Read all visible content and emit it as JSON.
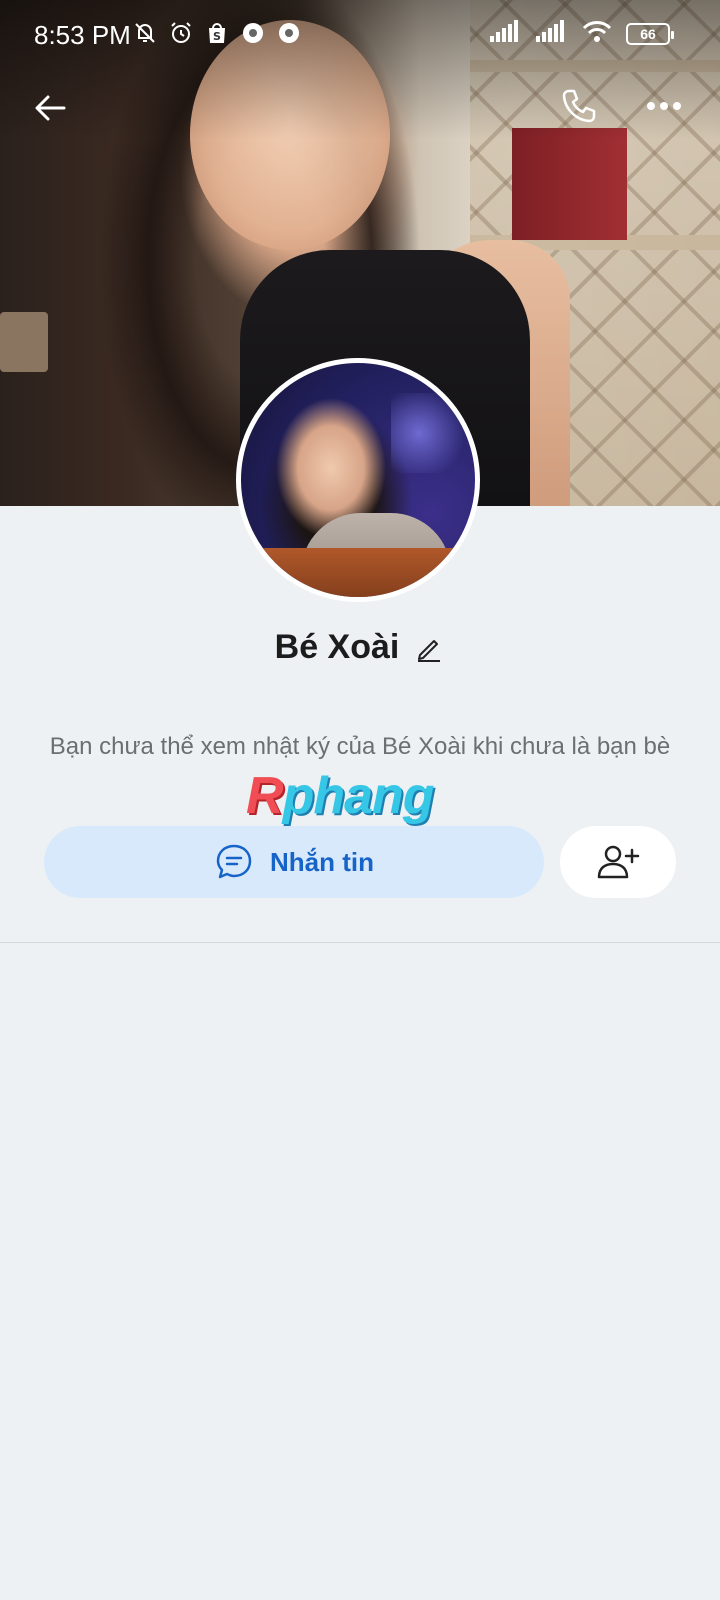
{
  "status_bar": {
    "time": "8:53 PM",
    "battery": "66",
    "left_icons": [
      "mute-bell-icon",
      "alarm-icon",
      "shopee-icon",
      "chrome-icon",
      "chrome-icon"
    ],
    "right_icons": [
      "signal-icon",
      "signal-icon",
      "wifi-icon",
      "battery-icon"
    ]
  },
  "header": {
    "back_icon": "back-arrow-icon",
    "call_icon": "phone-icon",
    "more_icon": "more-dots-icon"
  },
  "profile": {
    "name": "Bé Xoài",
    "notice": "Bạn chưa thể xem nhật ký của Bé Xoài khi chưa là bạn bè"
  },
  "actions": {
    "message_label": "Nhắn tin",
    "message_icon": "chat-bubble-icon",
    "add_friend_icon": "add-friend-icon"
  },
  "watermark": {
    "text_first": "R",
    "text_rest": "phang"
  },
  "colors": {
    "background": "#eef1f3",
    "accent": "#1764c8",
    "message_button_bg": "#d8e9fc"
  }
}
